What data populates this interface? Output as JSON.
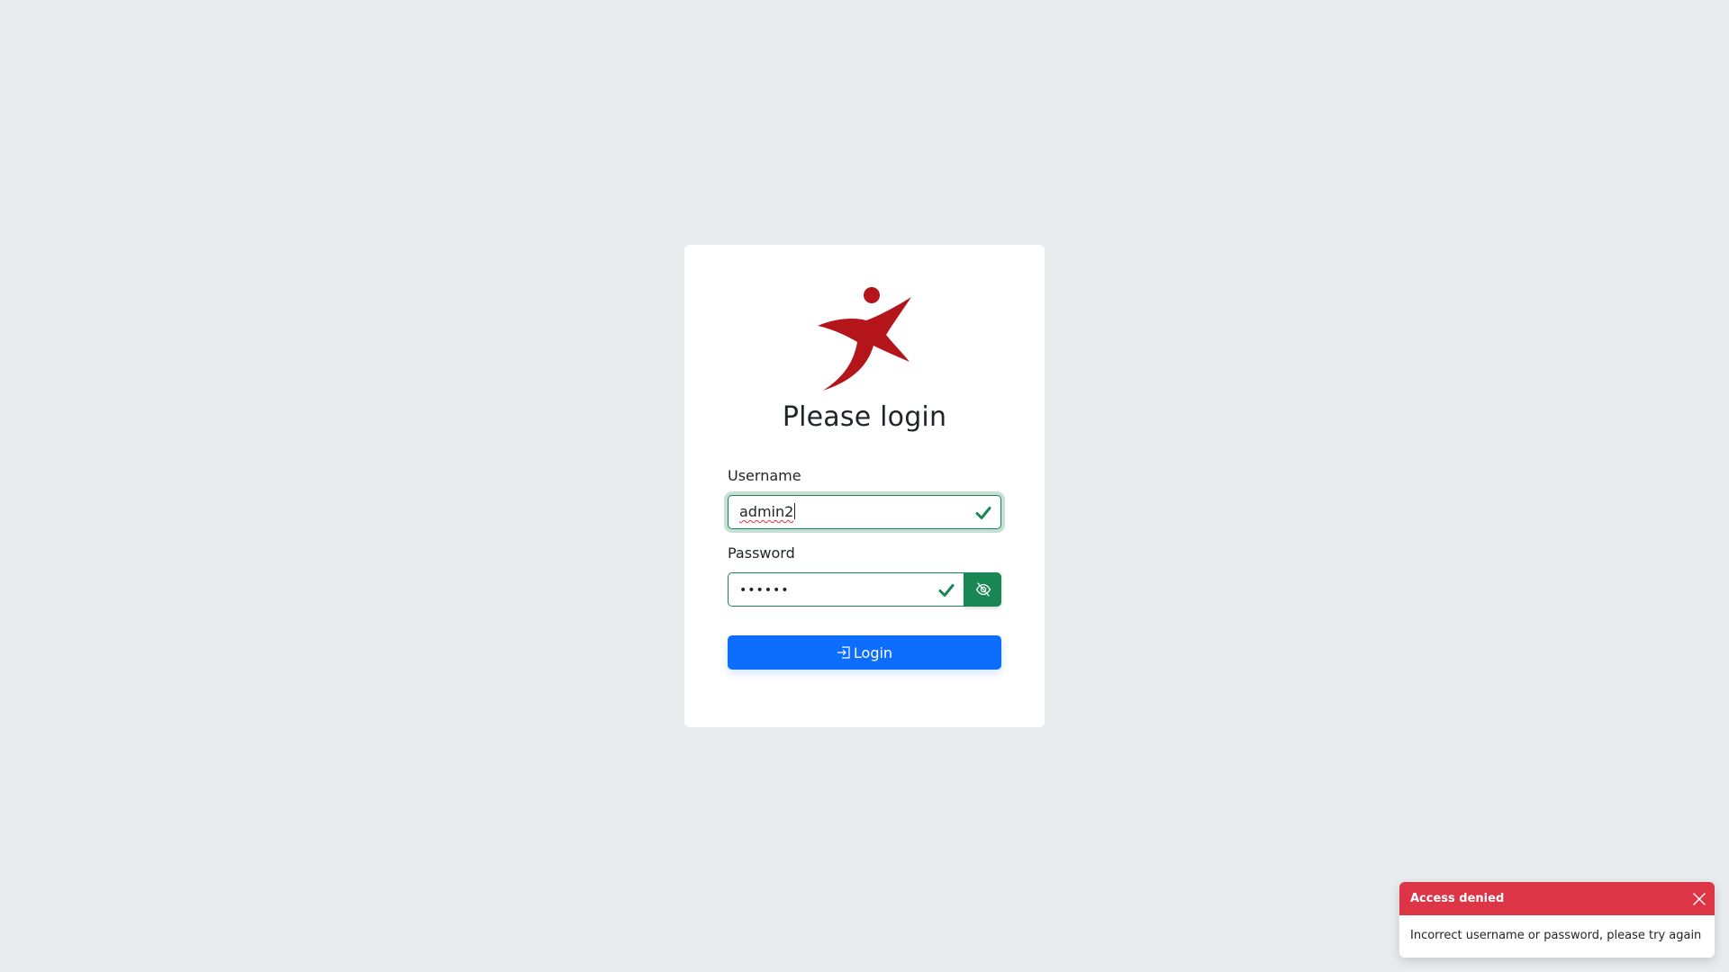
{
  "login": {
    "title": "Please login",
    "username_label": "Username",
    "username_value": "admin2",
    "password_label": "Password",
    "password_value": "••••••",
    "login_button_label": "Login"
  },
  "toast": {
    "title": "Access denied",
    "message": "Incorrect username or password, please try again"
  },
  "icons": {
    "logo": "red-figure-logo",
    "valid": "check-icon",
    "toggle_password": "eye-slash-icon",
    "login": "box-arrow-in-right-icon",
    "close": "close-icon"
  },
  "colors": {
    "background": "#e9ecef",
    "card": "#ffffff",
    "success": "#198754",
    "primary": "#0d6efd",
    "danger": "#dc3545",
    "logo_red": "#b3151b"
  }
}
